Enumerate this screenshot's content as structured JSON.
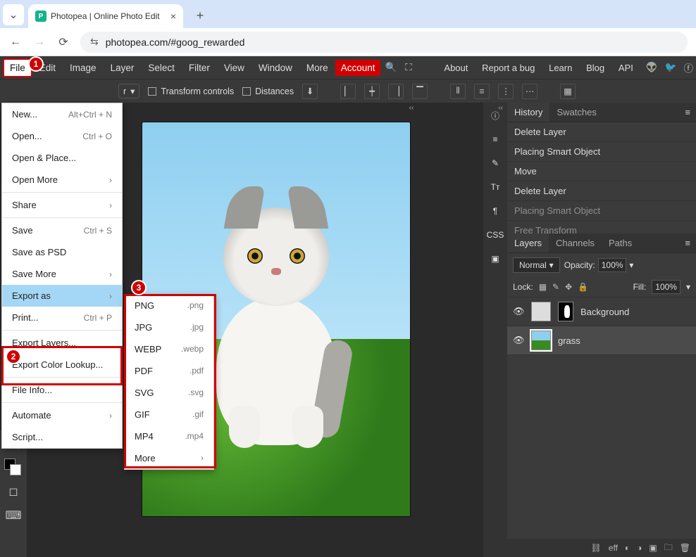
{
  "browser": {
    "tab_title": "Photopea | Online Photo Edit",
    "url_scheme_icon": "⇆",
    "url": "photopea.com/#goog_rewarded"
  },
  "menubar": {
    "items": [
      "File",
      "Edit",
      "Image",
      "Layer",
      "Select",
      "Filter",
      "View",
      "Window",
      "More"
    ],
    "account": "Account",
    "right_links": [
      "About",
      "Report a bug",
      "Learn",
      "Blog",
      "API"
    ]
  },
  "toolbar": {
    "transform_controls": "Transform controls",
    "distances": "Distances"
  },
  "file_menu": [
    {
      "label": "New...",
      "shortcut": "Alt+Ctrl + N"
    },
    {
      "label": "Open...",
      "shortcut": "Ctrl + O"
    },
    {
      "label": "Open & Place..."
    },
    {
      "label": "Open More",
      "submenu": true
    },
    {
      "sep": true
    },
    {
      "label": "Share",
      "submenu": true
    },
    {
      "sep": true
    },
    {
      "label": "Save",
      "shortcut": "Ctrl + S"
    },
    {
      "label": "Save as PSD"
    },
    {
      "label": "Save More",
      "submenu": true
    },
    {
      "label": "Export as",
      "submenu": true,
      "highlight": true
    },
    {
      "label": "Print...",
      "shortcut": "Ctrl + P"
    },
    {
      "sep": true
    },
    {
      "label": "Export Layers..."
    },
    {
      "label": "Export Color Lookup..."
    },
    {
      "sep": true
    },
    {
      "label": "File Info..."
    },
    {
      "sep": true
    },
    {
      "label": "Automate",
      "submenu": true
    },
    {
      "label": "Script..."
    }
  ],
  "export_submenu": [
    {
      "label": "PNG",
      "ext": ".png"
    },
    {
      "label": "JPG",
      "ext": ".jpg"
    },
    {
      "label": "WEBP",
      "ext": ".webp"
    },
    {
      "label": "PDF",
      "ext": ".pdf"
    },
    {
      "label": "SVG",
      "ext": ".svg"
    },
    {
      "label": "GIF",
      "ext": ".gif"
    },
    {
      "label": "MP4",
      "ext": ".mp4"
    },
    {
      "label": "More",
      "submenu": true
    }
  ],
  "midstrip_items": [
    "ⓘ",
    "≡",
    "✎",
    "Tᴛ",
    "¶",
    "CSS",
    "▣"
  ],
  "history": {
    "tabs": [
      "History",
      "Swatches"
    ],
    "items": [
      {
        "label": "Delete Layer"
      },
      {
        "label": "Placing Smart Object"
      },
      {
        "label": "Move"
      },
      {
        "label": "Delete Layer"
      },
      {
        "label": "Placing Smart Object",
        "dim": true
      },
      {
        "label": "Free Transform",
        "dim": true
      }
    ]
  },
  "layers_panel": {
    "tabs": [
      "Layers",
      "Channels",
      "Paths"
    ],
    "blend_mode": "Normal",
    "opacity_label": "Opacity:",
    "opacity": "100%",
    "lock_label": "Lock:",
    "fill_label": "Fill:",
    "fill": "100%",
    "layers": [
      {
        "name": "Background",
        "has_mask": true
      },
      {
        "name": "grass",
        "selected": true
      }
    ],
    "foot_icons": [
      "⛓",
      "eff",
      "◐",
      "◑",
      "▣",
      "🗀",
      "🗑"
    ]
  },
  "annotations": {
    "b1": "1",
    "b2": "2",
    "b3": "3"
  }
}
